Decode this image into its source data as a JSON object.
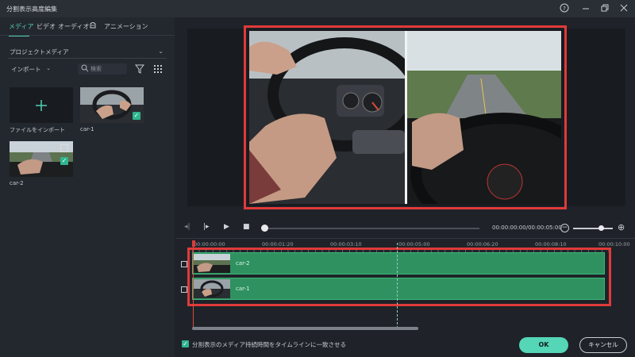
{
  "window": {
    "title": "分割表示高度編集"
  },
  "left_panel": {
    "tabs": [
      {
        "label": "メディア",
        "active": true
      },
      {
        "label": "ビデオ",
        "active": false
      },
      {
        "label": "オーディオ",
        "active": false
      },
      {
        "label": "",
        "icon": "sticker-icon",
        "active": false
      },
      {
        "label": "アニメーション",
        "active": false
      }
    ],
    "library_dropdown": "プロジェクトメディア",
    "import_dropdown": "インポート",
    "search_placeholder": "検索",
    "media_items": [
      {
        "caption": "ファイルをインポート",
        "type": "import"
      },
      {
        "caption": "car-1",
        "type": "clip",
        "checked": true
      },
      {
        "caption": "car-2",
        "type": "clip",
        "checked": true
      }
    ]
  },
  "transport": {
    "timecode": "00:00:00:00/00:00:05:00"
  },
  "timeline": {
    "ruler_labels": [
      "00:00:00:00",
      "00:00:01:20",
      "00:00:03:10",
      "00:00:05:00",
      "00:00:06:20",
      "00:00:08:10",
      "00:00:10:00"
    ],
    "tracks": [
      {
        "name": "car-2"
      },
      {
        "name": "car-1"
      }
    ]
  },
  "footer": {
    "match_duration_label": "分割表示のメディア持続時間をタイムラインに一致させる",
    "match_duration_checked": true,
    "ok_label": "OK",
    "cancel_label": "キャンセル"
  },
  "colors": {
    "accent": "#4fd1b0",
    "highlight_border": "#e03a3a",
    "clip_green": "#2f9160",
    "background": "#1f2329"
  }
}
